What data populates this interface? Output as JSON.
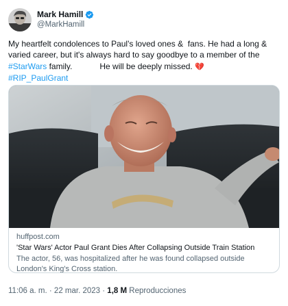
{
  "author": {
    "display_name": "Mark Hamill",
    "handle": "@MarkHamill",
    "verified": true,
    "verified_color": "#1d9bf0"
  },
  "tweet": {
    "text_part1": "My heartfelt condolences to Paul's loved ones &  fans. He had a long & varied career, but it's always hard to say goodbye to a member of the ",
    "hashtag_starwars": "#StarWars",
    "text_part2": " family.            He will be deeply missed. ",
    "emoji": "💔",
    "hashtag_rip": "#RIP_PaulGrant"
  },
  "card": {
    "domain": "huffpost.com",
    "title": "'Star Wars' Actor Paul Grant Dies After Collapsing Outside Train Station",
    "description": "The actor, 56, was hospitalized after he was found collapsed outside London's King's Cross station.",
    "image_icon": "photo-of-man-on-couch"
  },
  "meta": {
    "time": "11:06 a. m.",
    "separator": " · ",
    "date": "22 mar. 2023",
    "views_count": "1,8 M",
    "views_label": " Reproducciones"
  },
  "colors": {
    "link": "#1d9bf0",
    "text": "#0f1419",
    "secondary": "#536471",
    "border": "#cfd9de"
  }
}
